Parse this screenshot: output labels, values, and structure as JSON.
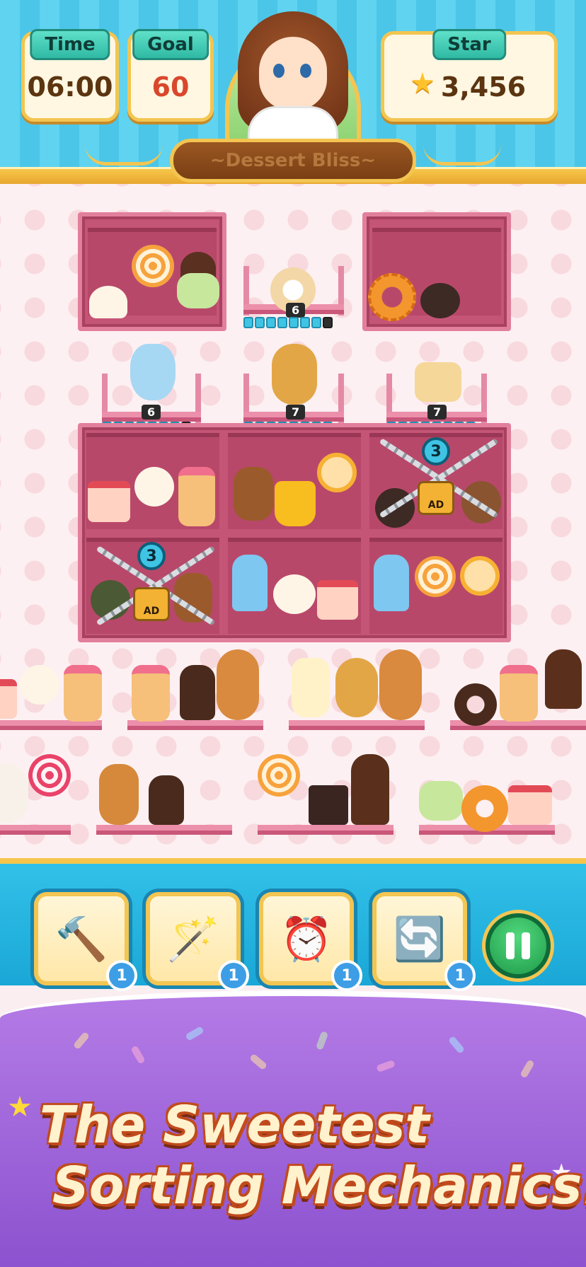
{
  "hud": {
    "time_label": "Time",
    "time_value": "06:00",
    "goal_label": "Goal",
    "goal_value": "60",
    "star_label": "Star",
    "star_value": "3,456",
    "level_title": "~Dessert Bliss~"
  },
  "shelves": {
    "small_shelf_counts": [
      "6",
      "6",
      "7",
      "7"
    ],
    "locked_cells": [
      {
        "unlock_count": "3",
        "ad_label": "AD"
      },
      {
        "unlock_count": "3",
        "ad_label": "AD"
      }
    ]
  },
  "toolbar": {
    "tools": [
      {
        "icon": "hammer-icon",
        "count": "1"
      },
      {
        "icon": "magic-wand-icon",
        "count": "1"
      },
      {
        "icon": "freeze-clock-icon",
        "count": "1"
      },
      {
        "icon": "shuffle-icon",
        "count": "1"
      }
    ]
  },
  "promo": {
    "line1": "The Sweetest",
    "line2": "Sorting Mechanics!"
  },
  "colors": {
    "header_blue": "#4bc6e8",
    "gold": "#f3c551",
    "shelf_pink": "#c55577",
    "promo_purple": "#9d63db"
  }
}
